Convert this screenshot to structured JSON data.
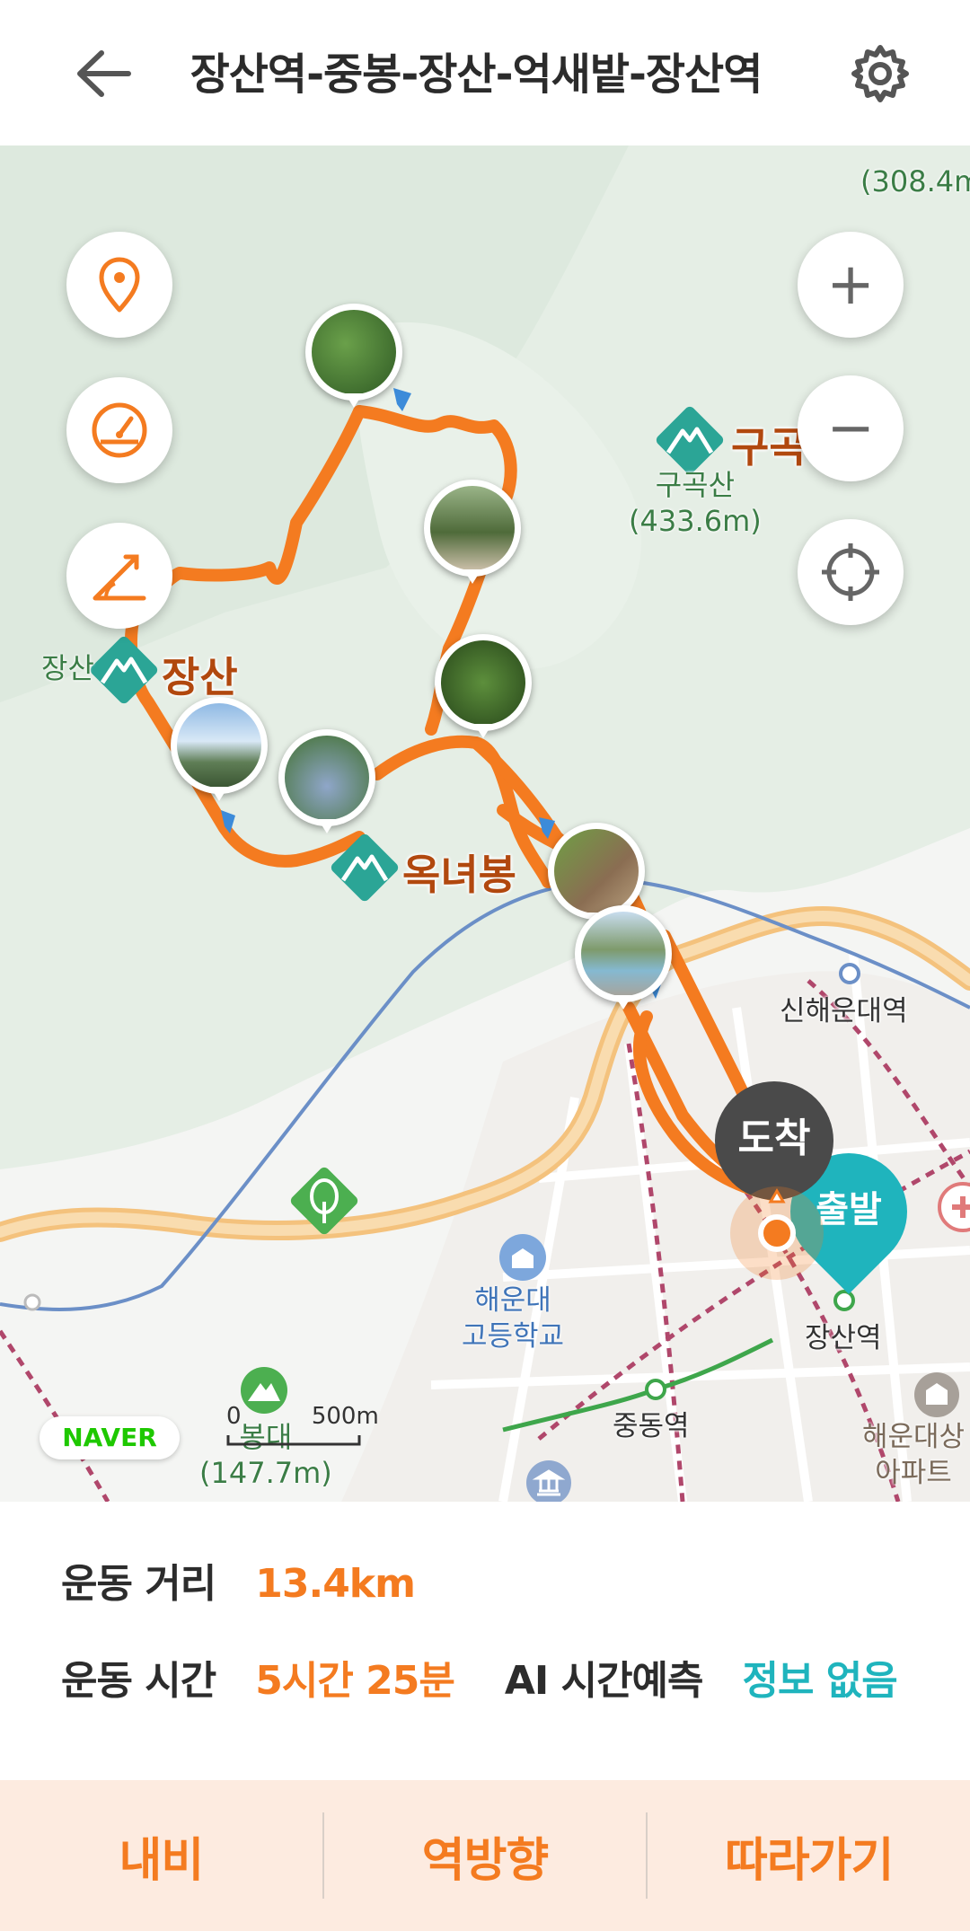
{
  "header": {
    "title": "장산역-중봉-장산-억새밭-장산역",
    "back_icon": "arrow-left-icon",
    "settings_icon": "gear-icon"
  },
  "map": {
    "controls": {
      "location_icon": "map-pin-icon",
      "speed_icon": "speedometer-icon",
      "elevation_icon": "elevation-slope-icon",
      "zoom_in": "+",
      "zoom_out": "−",
      "gps_icon": "crosshair-icon"
    },
    "labels": {
      "peak_gugok_name": "구곡",
      "peak_gugok_sub": "구곡산",
      "peak_gugok_height": "(433.6m)",
      "peak_jangsan_prefix": "장산",
      "peak_jangsan_name": "장산",
      "peak_oknyeobong": "옥녀봉",
      "top_right_height": "(308.4m",
      "sinhaeundae_station": "신해운대역",
      "haeundae_school_1": "해운대",
      "haeundae_school_2": "고등학교",
      "jangsan_station": "장산역",
      "jungdong_station": "중동역",
      "apt_1": "해운대상",
      "apt_2": "아파트",
      "bottom_peak_1": "봉대",
      "bottom_peak_2": "(147.7m)",
      "scale_zero": "0",
      "scale_label": "500m",
      "naver": "NAVER"
    },
    "markers": {
      "arrive": "도착",
      "depart": "출발"
    },
    "colors": {
      "route": "#f47b20",
      "forest": "#e6efe6",
      "road": "#f7c98a",
      "rail": "#6b8fc7",
      "peak": "#2ba596"
    }
  },
  "info": {
    "distance_label": "운동 거리",
    "distance_value": "13.4km",
    "time_label": "운동 시간",
    "time_value": "5시간 25분",
    "ai_label": "AI 시간예측",
    "ai_value": "정보 없음"
  },
  "bottom": {
    "navi": "내비",
    "reverse": "역방향",
    "follow": "따라가기"
  }
}
